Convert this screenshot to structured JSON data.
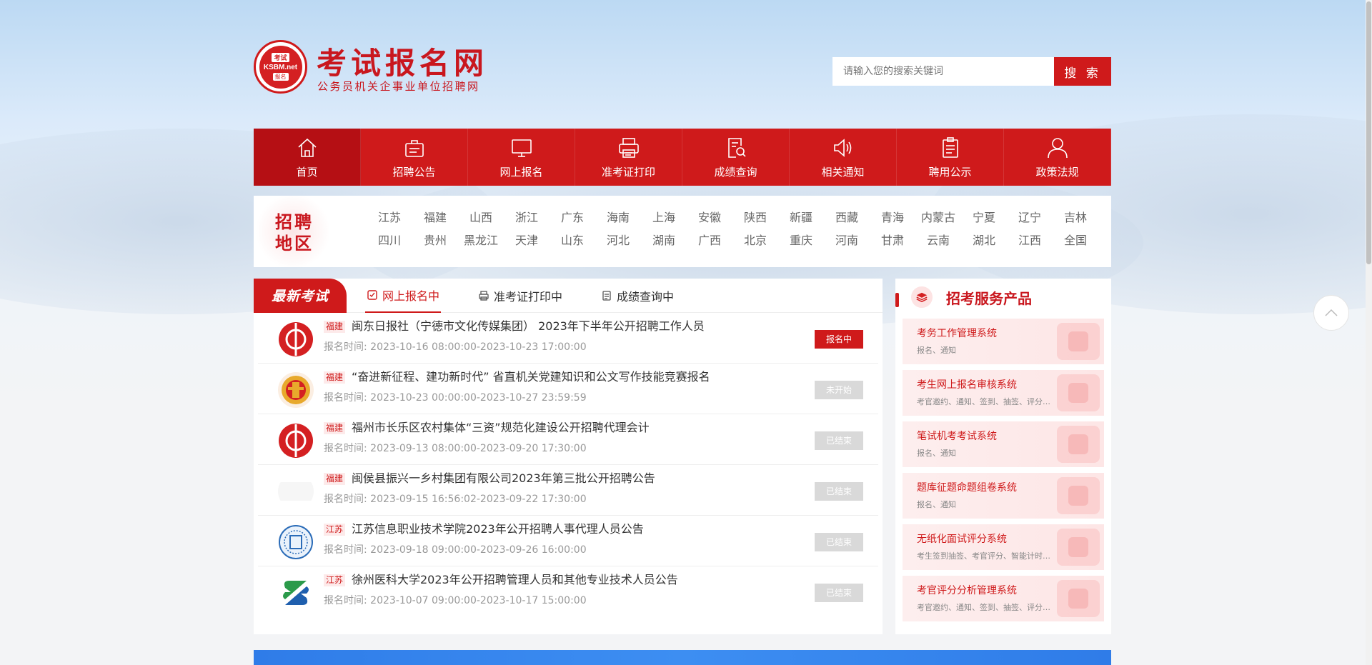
{
  "header": {
    "logo_top": "考试",
    "logo_mid": "KSBM.net",
    "logo_bottom": "报名",
    "site_title": "考试报名网",
    "site_subtitle": "公务员机关企事业单位招聘网",
    "search_placeholder": "请输入您的搜索关键词",
    "search_button": "搜 索"
  },
  "nav": {
    "items": [
      {
        "label": "首页",
        "icon": "home-icon"
      },
      {
        "label": "招聘公告",
        "icon": "briefcase-icon"
      },
      {
        "label": "网上报名",
        "icon": "monitor-icon"
      },
      {
        "label": "准考证打印",
        "icon": "printer-icon"
      },
      {
        "label": "成绩查询",
        "icon": "document-search-icon"
      },
      {
        "label": "相关通知",
        "icon": "speaker-icon"
      },
      {
        "label": "聘用公示",
        "icon": "clipboard-icon"
      },
      {
        "label": "政策法规",
        "icon": "user-icon"
      }
    ]
  },
  "region": {
    "badge_line1": "招聘",
    "badge_line2": "地区",
    "items": [
      "江苏",
      "福建",
      "山西",
      "浙江",
      "广东",
      "海南",
      "上海",
      "安徽",
      "陕西",
      "新疆",
      "西藏",
      "青海",
      "内蒙古",
      "宁夏",
      "辽宁",
      "吉林",
      "四川",
      "贵州",
      "黑龙江",
      "天津",
      "山东",
      "河北",
      "湖南",
      "广西",
      "北京",
      "重庆",
      "河南",
      "甘肃",
      "云南",
      "湖北",
      "江西",
      "全国"
    ]
  },
  "exams": {
    "flag": "最新考试",
    "tabs": [
      "网上报名中",
      "准考证打印中",
      "成绩查询中"
    ],
    "rows": [
      {
        "tag": "福建",
        "title": "闽东日报社（宁德市文化传媒集团） 2023年下半年公开招聘工作人员",
        "time_label": "报名时间:",
        "time": "2023-10-16 08:00:00-2023-10-23 17:00:00",
        "status": "报名中",
        "logo": "red-emblem"
      },
      {
        "tag": "福建",
        "title": "“奋进新征程、建功新时代” 省直机关党建知识和公文写作技能竞赛报名",
        "time_label": "报名时间:",
        "time": "2023-10-23 00:00:00-2023-10-27 23:59:59",
        "status": "未开始",
        "logo": "union-emblem"
      },
      {
        "tag": "福建",
        "title": "福州市长乐区农村集体“三资”规范化建设公开招聘代理会计",
        "time_label": "报名时间:",
        "time": "2023-09-13 08:00:00-2023-09-20 17:30:00",
        "status": "已结束",
        "logo": "red-emblem"
      },
      {
        "tag": "福建",
        "title": "闽侯县振兴一乡村集团有限公司2023年第三批公开招聘公告",
        "time_label": "报名时间:",
        "time": "2023-09-15 16:56:02-2023-09-22 17:30:00",
        "status": "已结束",
        "logo": "blank"
      },
      {
        "tag": "江苏",
        "title": "江苏信息职业技术学院2023年公开招聘人事代理人员公告",
        "time_label": "报名时间:",
        "time": "2023-09-18 09:00:00-2023-09-26 16:00:00",
        "status": "已结束",
        "logo": "blue-seal"
      },
      {
        "tag": "江苏",
        "title": "徐州医科大学2023年公开招聘管理人员和其他专业技术人员公告",
        "time_label": "报名时间:",
        "time": "2023-10-07 09:00:00-2023-10-17 15:00:00",
        "status": "已结束",
        "logo": "s-logo"
      }
    ]
  },
  "services": {
    "title": "招考服务产品",
    "items": [
      {
        "title": "考务工作管理系统",
        "desc": "报名、通知"
      },
      {
        "title": "考生网上报名审核系统",
        "desc": "考官邀约、通知、签到、抽签、评分分析"
      },
      {
        "title": "笔试机考考试系统",
        "desc": "报名、通知"
      },
      {
        "title": "题库征题命题组卷系统",
        "desc": "报名、通知"
      },
      {
        "title": "无纸化面试评分系统",
        "desc": "考生签到抽签、考官评分、智能计时暂停"
      },
      {
        "title": "考官评分分析管理系统",
        "desc": "考官邀约、通知、签到、抽签、评分分析"
      }
    ]
  },
  "colors": {
    "brand_red": "#cf1a1b",
    "nav_active": "#b50f14",
    "status_disabled": "#d9d9d9"
  }
}
